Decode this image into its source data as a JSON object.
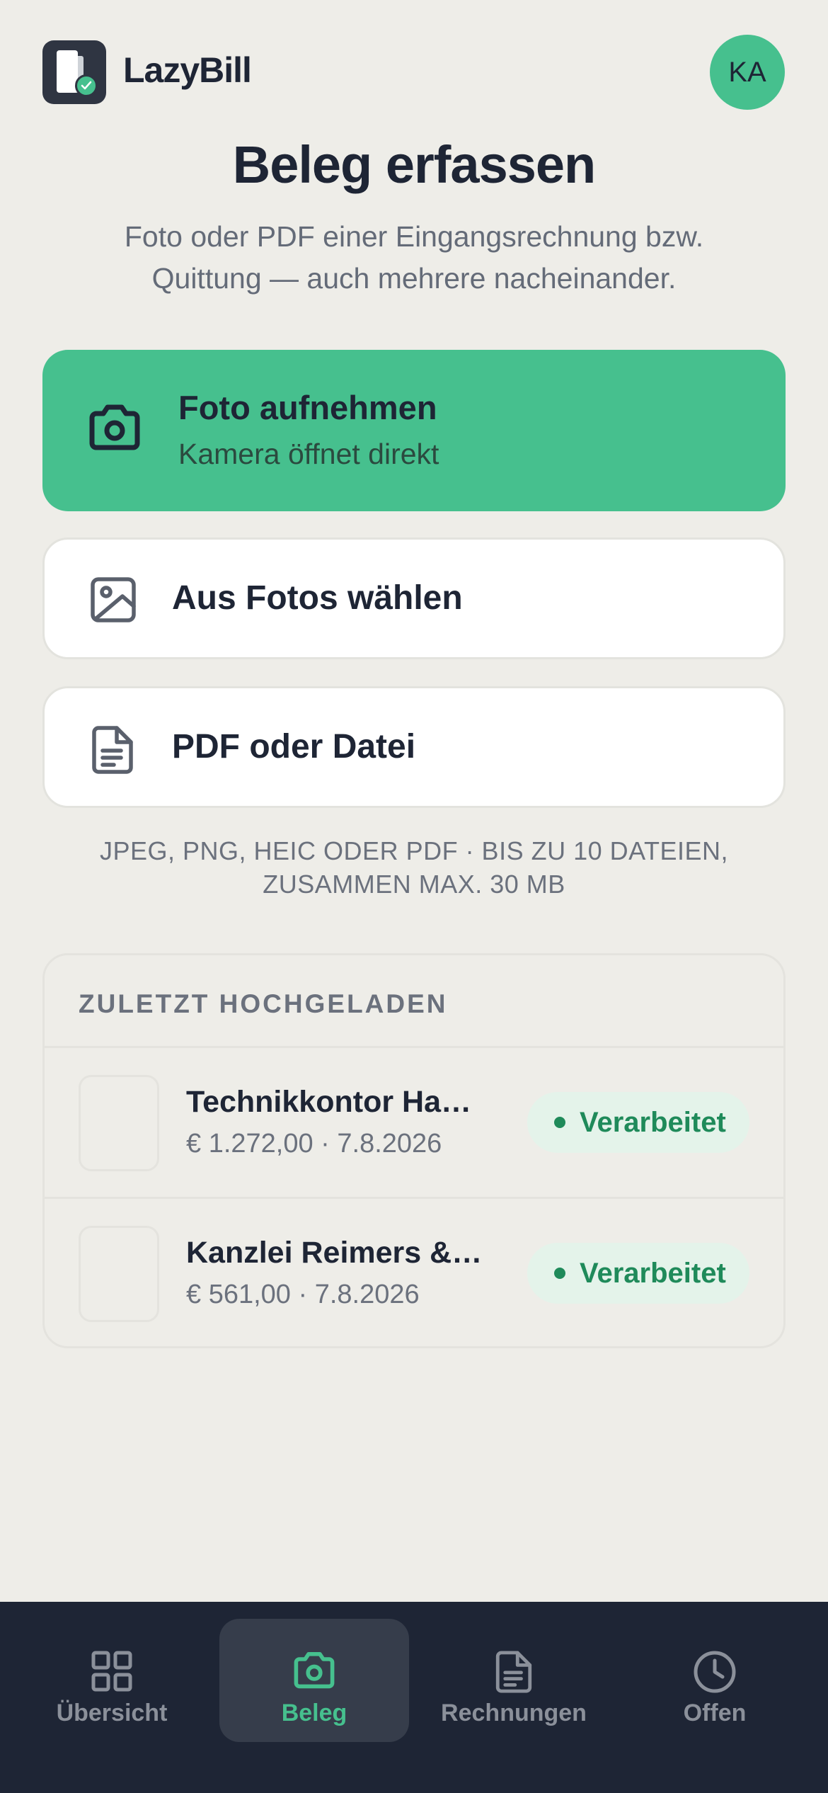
{
  "header": {
    "app_name": "LazyBill",
    "avatar_initials": "KA"
  },
  "page": {
    "title": "Beleg erfassen",
    "subtitle": "Foto oder PDF einer Eingangsrechnung bzw. Quittung — auch mehrere nacheinander."
  },
  "actions": {
    "camera": {
      "label": "Foto aufnehmen",
      "sublabel": "Kamera öffnet direkt",
      "icon": "camera-icon"
    },
    "photos": {
      "label": "Aus Fotos wählen",
      "icon": "image-icon"
    },
    "file": {
      "label": "PDF oder Datei",
      "icon": "file-text-icon"
    }
  },
  "hint": "JPEG, PNG, HEIC ODER PDF · BIS ZU 10 DATEIEN, ZUSAMMEN MAX. 30 MB",
  "recent": {
    "heading": "ZULETZT HOCHGELADEN",
    "items": [
      {
        "title": "Technikkontor Ham…",
        "meta": "€ 1.272,00 · 7.8.2026",
        "status": "Verarbeitet"
      },
      {
        "title": "Kanzlei Reimers & K…",
        "meta": "€ 561,00 · 7.8.2026",
        "status": "Verarbeitet"
      }
    ]
  },
  "tabbar": {
    "items": [
      {
        "label": "Übersicht",
        "icon": "grid-icon"
      },
      {
        "label": "Beleg",
        "icon": "camera-icon"
      },
      {
        "label": "Rechnungen",
        "icon": "file-text-icon"
      },
      {
        "label": "Offen",
        "icon": "clock-icon"
      }
    ],
    "active": "Beleg"
  },
  "colors": {
    "accent": "#46c08e",
    "background": "#eeede8",
    "dark": "#1e2535",
    "status_green": "#1f8a5a"
  }
}
